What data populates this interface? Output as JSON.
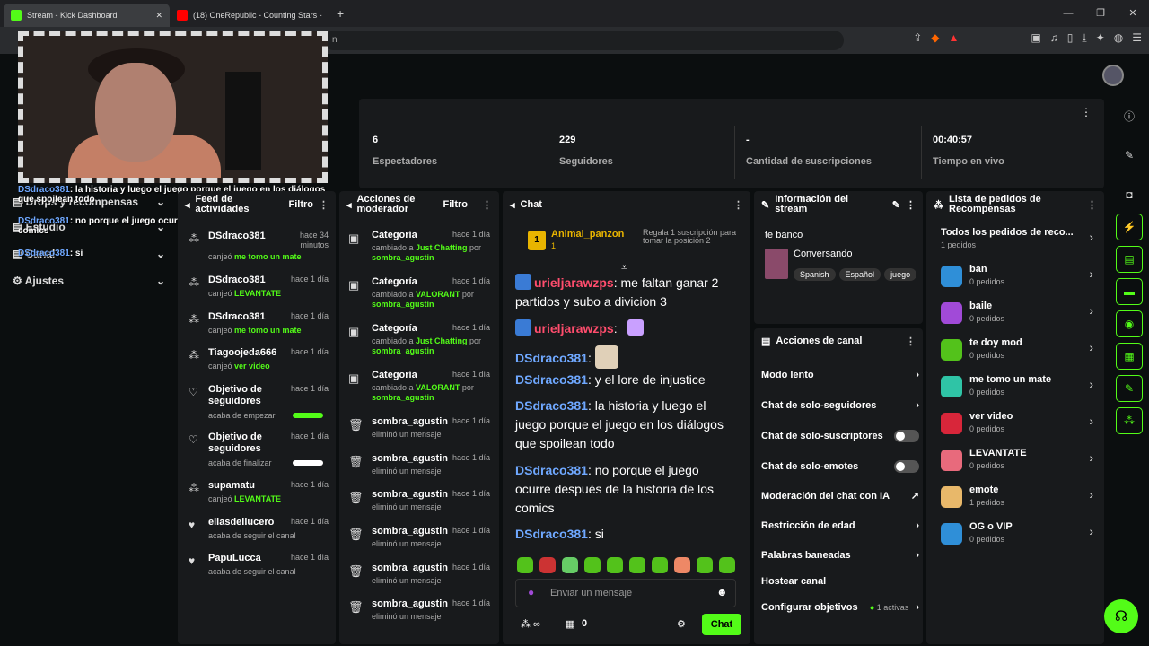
{
  "browser": {
    "tabs": [
      {
        "title": "Stream - Kick Dashboard",
        "icon_color": "#53fc18"
      },
      {
        "title": "(18) OneRepublic - Counting Stars -",
        "icon_color": "#ff0000"
      }
    ],
    "new_tab": "+",
    "url_fragment": "n",
    "window_controls": [
      "—",
      "❐",
      "✕"
    ]
  },
  "sidebar": {
    "items": [
      {
        "label": "Drops y recompensas",
        "icon": "gift-icon"
      },
      {
        "label": "Estudio",
        "icon": "studio-icon"
      },
      {
        "label": "Canal",
        "icon": "channel-icon"
      },
      {
        "label": "Ajustes",
        "icon": "gear-icon"
      }
    ]
  },
  "overlay_chat": [
    {
      "user": "DSdraco381",
      "text": "la historia y luego el juego porque el juego en los diálogos que spoilean todo"
    },
    {
      "user": "DSdraco381",
      "text": "no porque el juego ocurre después de la historia de los comics"
    },
    {
      "user": "DSdraco381",
      "text": "si"
    }
  ],
  "stats": [
    {
      "value": "6",
      "label": "Espectadores"
    },
    {
      "value": "229",
      "label": "Seguidores"
    },
    {
      "value": "-",
      "label": "Cantidad de suscripciones"
    },
    {
      "value": "00:40:57",
      "label": "Tiempo en vivo"
    }
  ],
  "activity_feed": {
    "title": "Feed de actividades",
    "filter": "Filtro",
    "items": [
      {
        "user": "DSdraco381",
        "time": "hace 34 minutos",
        "action": "canjeó",
        "target": "me tomo un mate",
        "icon": "redeem-icon"
      },
      {
        "user": "DSdraco381",
        "time": "hace 1 día",
        "action": "canjeó",
        "target": "LEVANTATE",
        "icon": "redeem-icon"
      },
      {
        "user": "DSdraco381",
        "time": "hace 1 día",
        "action": "canjeó",
        "target": "me tomo un mate",
        "icon": "redeem-icon"
      },
      {
        "user": "Tiagoojeda666",
        "time": "hace 1 día",
        "action": "canjeó",
        "target": "ver video",
        "icon": "redeem-icon"
      },
      {
        "user": "Objetivo de seguidores",
        "time": "hace 1 día",
        "action": "acaba de empezar",
        "target": "",
        "icon": "heart-outline-icon",
        "progress": "green"
      },
      {
        "user": "Objetivo de seguidores",
        "time": "hace 1 día",
        "action": "acaba de finalizar",
        "target": "",
        "icon": "heart-outline-icon",
        "progress": "white"
      },
      {
        "user": "supamatu",
        "time": "hace 1 día",
        "action": "canjeó",
        "target": "LEVANTATE",
        "icon": "redeem-icon"
      },
      {
        "user": "eliasdellucero",
        "time": "hace 1 día",
        "action": "acaba de seguir el canal",
        "target": "",
        "icon": "heart-icon"
      },
      {
        "user": "PapuLucca",
        "time": "hace 1 día",
        "action": "acaba de seguir el canal",
        "target": "",
        "icon": "heart-icon"
      }
    ]
  },
  "mod_actions": {
    "title": "Acciones de moderador",
    "filter": "Filtro",
    "items": [
      {
        "title": "Categoría",
        "time": "hace 1 día",
        "pre": "cambiado a",
        "target": "Just Chatting",
        "by": "sombra_agustin"
      },
      {
        "title": "Categoría",
        "time": "hace 1 día",
        "pre": "cambiado a",
        "target": "VALORANT",
        "by": "sombra_agustin"
      },
      {
        "title": "Categoría",
        "time": "hace 1 día",
        "pre": "cambiado a",
        "target": "Just Chatting",
        "by": "sombra_agustin"
      },
      {
        "title": "Categoría",
        "time": "hace 1 día",
        "pre": "cambiado a",
        "target": "VALORANT",
        "by": "sombra_agustin"
      },
      {
        "title": "sombra_agustin",
        "time": "hace 1 día",
        "pre": "eliminó un mensaje"
      },
      {
        "title": "sombra_agustin",
        "time": "hace 1 día",
        "pre": "eliminó un mensaje"
      },
      {
        "title": "sombra_agustin",
        "time": "hace 1 día",
        "pre": "eliminó un mensaje"
      },
      {
        "title": "sombra_agustin",
        "time": "hace 1 día",
        "pre": "eliminó un mensaje"
      },
      {
        "title": "sombra_agustin",
        "time": "hace 1 día",
        "pre": "eliminó un mensaje"
      },
      {
        "title": "sombra_agustin",
        "time": "hace 1 día",
        "pre": "eliminó un mensaje"
      }
    ]
  },
  "chat": {
    "title": "Chat",
    "pinned": {
      "user": "Animal_panzon",
      "count": "1",
      "gift_text": "Regala 1 suscripción para tomar la posición 2"
    },
    "messages": [
      {
        "user": "urieljarawzps",
        "text": "me faltan ganar 2 partidos y subo a divicion 3",
        "color": "red"
      },
      {
        "user": "urieljarawzps",
        "text": "",
        "color": "red"
      },
      {
        "user": "DSdraco381",
        "text": "",
        "color": "blue"
      },
      {
        "user": "DSdraco381",
        "text": "y el lore de injustice",
        "color": "blue"
      },
      {
        "user": "DSdraco381",
        "text": "la historia y luego el juego porque el juego en los diálogos que spoilean todo",
        "color": "blue"
      },
      {
        "user": "DSdraco381",
        "text": "no porque el juego ocurre después de la historia de los comics",
        "color": "blue"
      },
      {
        "user": "DSdraco381",
        "text": "si",
        "color": "blue"
      }
    ],
    "placeholder": "Enviar un mensaje",
    "points": "0",
    "send_label": "Chat"
  },
  "stream_info": {
    "title": "Información del stream",
    "stream_title": "te banco",
    "category": "Conversando",
    "tags": [
      "Spanish",
      "Español",
      "juego"
    ]
  },
  "channel_actions": {
    "title": "Acciones de canal",
    "items": [
      {
        "label": "Modo lento",
        "control": "chevron"
      },
      {
        "label": "Chat de solo-seguidores",
        "control": "chevron"
      },
      {
        "label": "Chat de solo-suscriptores",
        "control": "toggle"
      },
      {
        "label": "Chat de solo-emotes",
        "control": "toggle"
      },
      {
        "label": "Moderación del chat con IA",
        "control": "external"
      },
      {
        "label": "Restricción de edad",
        "control": "chevron"
      },
      {
        "label": "Palabras baneadas",
        "control": "chevron"
      },
      {
        "label": "Hostear canal",
        "control": "none"
      },
      {
        "label": "Configurar objetivos",
        "control": "chevron",
        "extra": "1 activas"
      }
    ]
  },
  "rewards": {
    "title": "Lista de pedidos de Recompensas",
    "all": {
      "label": "Todos los pedidos de reco...",
      "count": "1 pedidos"
    },
    "items": [
      {
        "name": "ban",
        "count": "0 pedidos",
        "color": "#2f8fd8"
      },
      {
        "name": "baile",
        "count": "0 pedidos",
        "color": "#a14ad8"
      },
      {
        "name": "te doy mod",
        "count": "0 pedidos",
        "color": "#53c21b"
      },
      {
        "name": "me tomo un mate",
        "count": "0 pedidos",
        "color": "#2fc4a6"
      },
      {
        "name": "ver video",
        "count": "0 pedidos",
        "color": "#d8263a"
      },
      {
        "name": "LEVANTATE",
        "count": "0 pedidos",
        "color": "#e86a7c"
      },
      {
        "name": "emote",
        "count": "1 pedidos",
        "color": "#e8b86a"
      },
      {
        "name": "OG o VIP",
        "count": "0 pedidos",
        "color": "#2f8fd8"
      }
    ]
  },
  "colors": {
    "accent": "#53fc18",
    "panel": "#181a1c",
    "bg": "#0b0e0f"
  }
}
